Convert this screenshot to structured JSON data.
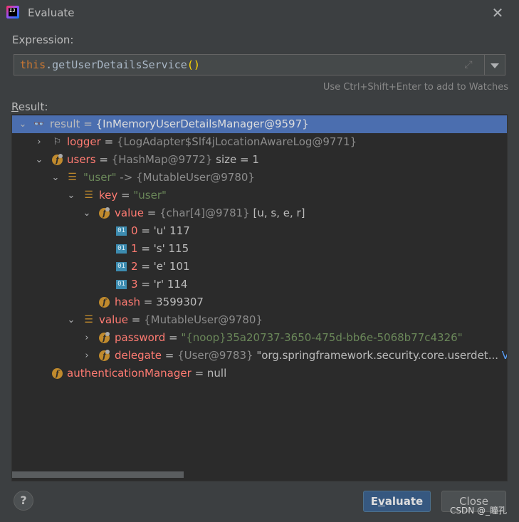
{
  "window": {
    "title": "Evaluate",
    "app_icon_text": "IJ"
  },
  "expression": {
    "label": "Expression:",
    "keyword": "this",
    "dot": ".",
    "method": "getUserDetailsService",
    "parens": "()",
    "hint": "Use Ctrl+Shift+Enter to add to Watches"
  },
  "result": {
    "label_underlined": "R",
    "label_rest": "esult:",
    "rows": [
      {
        "id": "result",
        "name": "result",
        "eq": " = ",
        "type": "{InMemoryUserDetailsManager@9597}",
        "extra": ""
      },
      {
        "id": "logger",
        "name": "logger",
        "eq": " = ",
        "type": "{LogAdapter$Slf4jLocationAwareLog@9771}",
        "extra": ""
      },
      {
        "id": "users",
        "name": "users",
        "eq": " = ",
        "type": "{HashMap@9772}",
        "extra": "  size = 1"
      },
      {
        "id": "entry",
        "name": "\"user\"",
        "eq": " -> ",
        "type": "{MutableUser@9780}",
        "extra": ""
      },
      {
        "id": "key",
        "name": "key",
        "eq": " = ",
        "type": "",
        "extra": "\"user\""
      },
      {
        "id": "value",
        "name": "value",
        "eq": " = ",
        "type": "{char[4]@9781}",
        "extra": " [u, s, e, r]"
      },
      {
        "id": "c0",
        "name": "0",
        "eq": " = ",
        "type": "",
        "extra": "'u' 117"
      },
      {
        "id": "c1",
        "name": "1",
        "eq": " = ",
        "type": "",
        "extra": "'s' 115"
      },
      {
        "id": "c2",
        "name": "2",
        "eq": " = ",
        "type": "",
        "extra": "'e' 101"
      },
      {
        "id": "c3",
        "name": "3",
        "eq": " = ",
        "type": "",
        "extra": "'r' 114"
      },
      {
        "id": "hash",
        "name": "hash",
        "eq": " = ",
        "type": "",
        "extra": "3599307"
      },
      {
        "id": "value2",
        "name": "value",
        "eq": " = ",
        "type": "{MutableUser@9780}",
        "extra": ""
      },
      {
        "id": "password",
        "name": "password",
        "eq": " = ",
        "type": "",
        "extra": "\"{noop}35a20737-3650-475d-bb6e-5068b77c4326\""
      },
      {
        "id": "delegate",
        "name": "delegate",
        "eq": " = ",
        "type": "{User@9783}",
        "extra": " \"org.springframework.security.core.userdet...",
        "link": " View"
      },
      {
        "id": "authman",
        "name": "authenticationManager",
        "eq": " = ",
        "type": "",
        "extra": "null"
      }
    ]
  },
  "buttons": {
    "help": "?",
    "evaluate_pre": "E",
    "evaluate_mnemonic": "v",
    "evaluate_post": "aluate",
    "close": "Close"
  },
  "watermark": "CSDN @_瞳孔",
  "icons": {
    "close": "close-icon",
    "expand": "expand-icon",
    "dropdown": "chevron-down-icon",
    "field": "field-icon",
    "list": "list-icon",
    "primitive": "primitive-icon",
    "flag": "flag-icon",
    "watch": "watch-icon"
  }
}
